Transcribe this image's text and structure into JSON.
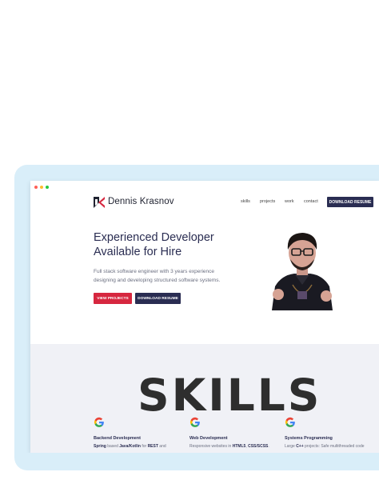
{
  "window": {
    "dot_colors": [
      "#ff5f57",
      "#febc2e",
      "#28c840"
    ]
  },
  "nav": {
    "brand": "Dennis Krasnov",
    "links": [
      "skills",
      "projects",
      "work",
      "contact"
    ],
    "download_resume": "DOWNLOAD RESUME"
  },
  "hero": {
    "title_line1": "Experienced Developer",
    "title_line2": "Available for Hire",
    "subtitle_line1": "Full stack software engineer with 3 years experience",
    "subtitle_line2": "designing and developing structured software systems.",
    "view_projects": "VIEW PROJECTS",
    "download_resume": "DOWNLOAD RESUME"
  },
  "skills": {
    "heading": "SKILLS",
    "cards": [
      {
        "title": "Backend Development",
        "d1": "Spring",
        "d2": " based ",
        "d3": "Java/Kotlin",
        "d4": " for ",
        "d5": "REST",
        "d6": " and"
      },
      {
        "title": "Web Development",
        "d1": "Responsive websites in ",
        "d2": "HTML5",
        "d3": ", ",
        "d4": "CSS/SCSS",
        "d5": ".",
        "d6": ""
      },
      {
        "title": "Systems Programming",
        "d1": "Large ",
        "d2": "C++",
        "d3": " projects: Safe multithreaded code",
        "d4": "",
        "d5": "",
        "d6": ""
      }
    ]
  },
  "colors": {
    "accent_red": "#d6273f",
    "navy": "#2a2d52",
    "frame": "#d9eef9"
  }
}
